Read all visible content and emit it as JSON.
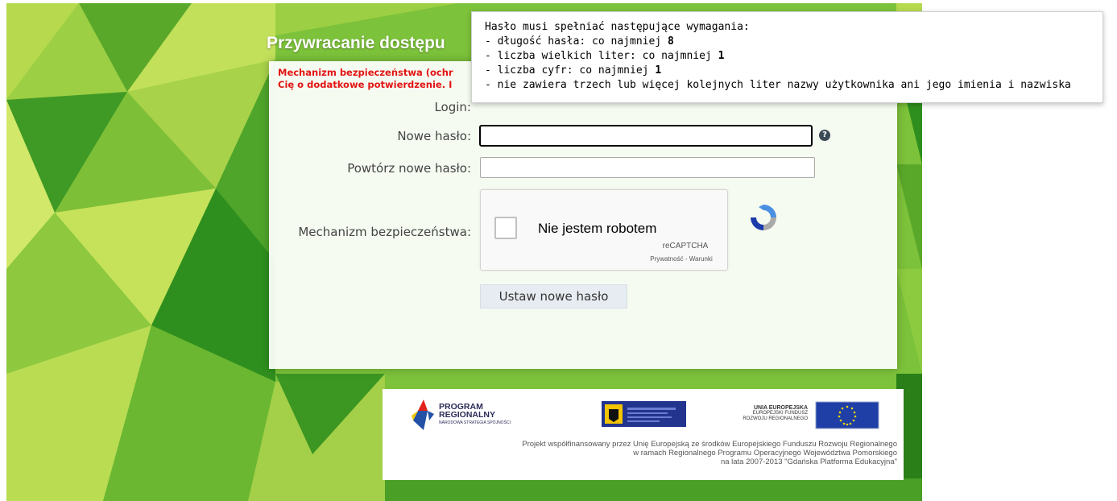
{
  "page": {
    "title": "Przywracanie dostępu",
    "warning_lines": [
      "Mechanizm bezpieczeństwa (ochr",
      "Cię o dodatkowe potwierdzenie. I"
    ]
  },
  "form": {
    "login_label": "Login:",
    "new_password_label": "Nowe hasło:",
    "repeat_password_label": "Powtórz nowe hasło:",
    "security_label": "Mechanizm bezpieczeństwa:",
    "help_icon": "question-circle-icon",
    "submit_label": "Ustaw nowe hasło"
  },
  "captcha": {
    "checkbox_label": "Nie jestem robotem",
    "brand": "reCAPTCHA",
    "terms": "Prywatność - Warunki"
  },
  "tooltip": {
    "heading": "Hasło musi spełniać następujące wymagania:",
    "rules": [
      {
        "text": "- długość hasła: co najmniej ",
        "value": "8"
      },
      {
        "text": "- liczba wielkich liter: co najmniej ",
        "value": "1"
      },
      {
        "text": "- liczba cyfr: co najmniej ",
        "value": "1"
      },
      {
        "text": "- nie zawiera trzech lub więcej kolejnych liter nazwy użytkownika ani jego imienia i nazwiska",
        "value": ""
      }
    ]
  },
  "footer": {
    "program_line1": "PROGRAM",
    "program_line2": "REGIONALNY",
    "program_sub": "NARODOWA STRATEGIA SPÓJNOŚCI",
    "eu_main": "UNIA EUROPEJSKA",
    "eu_sub1": "EUROPEJSKI FUNDUSZ",
    "eu_sub2": "ROZWOJU REGIONALNEGO",
    "text_lines": [
      "Projekt współfinansowany przez Unię Europejską ze środków Europejskiego Funduszu Rozwoju Regionalnego",
      "w ramach Regionalnego Programu Operacyjnego Województwa Pomorskiego",
      "na lata 2007-2013 \"Gdańska Platforma Edukacyjna\""
    ]
  },
  "colors": {
    "warning": "#e21414",
    "bg_green_dark": "#2f8f1e",
    "bg_green_light": "#c8e35a"
  }
}
